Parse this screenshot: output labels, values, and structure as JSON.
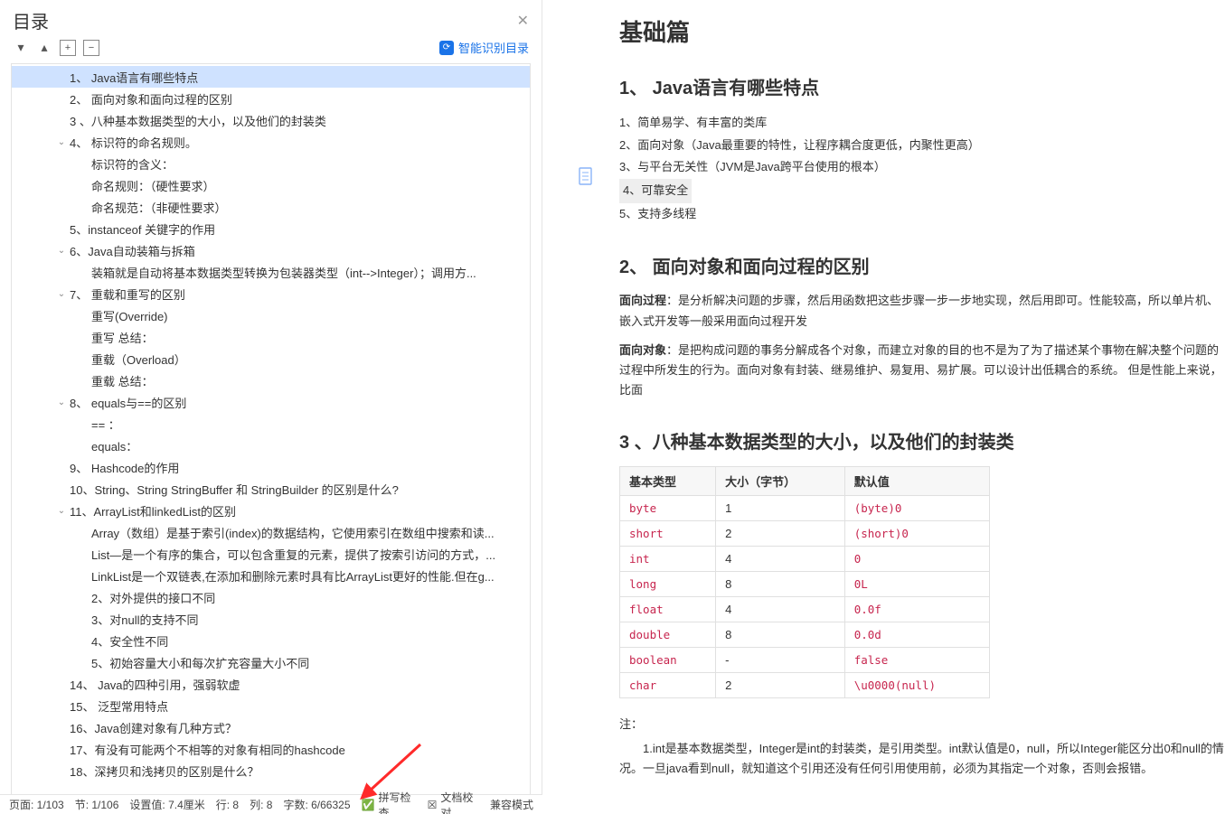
{
  "outline_panel": {
    "title": "目录",
    "smart_label": "智能识别目录",
    "buttons": {
      "collapse_all": "▾",
      "up": "▴",
      "add": "+",
      "remove": "−"
    }
  },
  "outline_items": [
    {
      "level": 0,
      "caret": "",
      "label": "1、 Java语言有哪些特点",
      "selected": true
    },
    {
      "level": 0,
      "caret": "",
      "label": "2、 面向对象和面向过程的区别"
    },
    {
      "level": 0,
      "caret": "",
      "label": "3 、八种基本数据类型的大小，以及他们的封装类"
    },
    {
      "level": 0,
      "caret": "open",
      "label": "4、 标识符的命名规则。"
    },
    {
      "level": 1,
      "caret": "",
      "label": "标识符的含义："
    },
    {
      "level": 1,
      "caret": "",
      "label": "命名规则：（硬性要求）"
    },
    {
      "level": 1,
      "caret": "",
      "label": "命名规范：（非硬性要求）"
    },
    {
      "level": 0,
      "caret": "",
      "label": "5、instanceof 关键字的作用"
    },
    {
      "level": 0,
      "caret": "open",
      "label": "6、Java自动装箱与拆箱"
    },
    {
      "level": 1,
      "caret": "",
      "label": "装箱就是自动将基本数据类型转换为包装器类型（int-->Integer）；调用方..."
    },
    {
      "level": 0,
      "caret": "open",
      "label": "7、 重载和重写的区别"
    },
    {
      "level": 1,
      "caret": "",
      "label": "重写(Override)"
    },
    {
      "level": 1,
      "caret": "",
      "label": "重写 总结："
    },
    {
      "level": 1,
      "caret": "",
      "label": "重载（Overload）"
    },
    {
      "level": 1,
      "caret": "",
      "label": "重载 总结："
    },
    {
      "level": 0,
      "caret": "open",
      "label": "8、 equals与==的区别"
    },
    {
      "level": 1,
      "caret": "",
      "label": "==  ："
    },
    {
      "level": 1,
      "caret": "",
      "label": "equals："
    },
    {
      "level": 0,
      "caret": "",
      "label": "9、 Hashcode的作用"
    },
    {
      "level": 0,
      "caret": "",
      "label": "10、String、String StringBuffer 和 StringBuilder 的区别是什么?"
    },
    {
      "level": 0,
      "caret": "open",
      "label": "11、ArrayList和linkedList的区别"
    },
    {
      "level": 1,
      "caret": "",
      "label": "Array（数组）是基于索引(index)的数据结构，它使用索引在数组中搜索和读..."
    },
    {
      "level": 1,
      "caret": "",
      "label": "List—是一个有序的集合，可以包含重复的元素，提供了按索引访问的方式，..."
    },
    {
      "level": 1,
      "caret": "",
      "label": "LinkList是一个双链表,在添加和删除元素时具有比ArrayList更好的性能.但在g..."
    },
    {
      "level": 1,
      "caret": "",
      "label": "2、对外提供的接口不同"
    },
    {
      "level": 1,
      "caret": "",
      "label": "3、对null的支持不同"
    },
    {
      "level": 1,
      "caret": "",
      "label": "4、安全性不同"
    },
    {
      "level": 1,
      "caret": "",
      "label": "5、初始容量大小和每次扩充容量大小不同"
    },
    {
      "level": 0,
      "caret": "",
      "label": "14、 Java的四种引用，强弱软虚"
    },
    {
      "level": 0,
      "caret": "",
      "label": "15、 泛型常用特点"
    },
    {
      "level": 0,
      "caret": "",
      "label": "16、Java创建对象有几种方式？"
    },
    {
      "level": 0,
      "caret": "",
      "label": "17、有没有可能两个不相等的对象有相同的hashcode"
    },
    {
      "level": 0,
      "caret": "",
      "label": "18、深拷贝和浅拷贝的区别是什么？"
    }
  ],
  "doc": {
    "h_basic": "基础篇",
    "h1": "1、 Java语言有哪些特点",
    "p1_1": "1、简单易学、有丰富的类库",
    "p1_2": "2、面向对象（Java最重要的特性，让程序耦合度更低，内聚性更高）",
    "p1_3": "3、与平台无关性（JVM是Java跨平台使用的根本）",
    "p1_4": "4、可靠安全",
    "p1_5": "5、支持多线程",
    "h2": "2、 面向对象和面向过程的区别",
    "s2a_label": "面向过程",
    "s2a_body": "：是分析解决问题的步骤，然后用函数把这些步骤一步一步地实现，然后用即可。性能较高，所以单片机、嵌入式开发等一般采用面向过程开发",
    "s2b_label": "面向对象",
    "s2b_body": "：是把构成问题的事务分解成各个对象，而建立对象的目的也不是为了为了描述某个事物在解决整个问题的过程中所发生的行为。面向对象有封装、继易维护、易复用、易扩展。可以设计出低耦合的系统。 但是性能上来说，比面",
    "h3": "3 、八种基本数据类型的大小，以及他们的封装类",
    "table_head": [
      "基本类型",
      "大小（字节）",
      "默认值"
    ],
    "table_rows": [
      [
        "byte",
        "1",
        "(byte)0"
      ],
      [
        "short",
        "2",
        "(short)0"
      ],
      [
        "int",
        "4",
        "0"
      ],
      [
        "long",
        "8",
        "0L"
      ],
      [
        "float",
        "4",
        "0.0f"
      ],
      [
        "double",
        "8",
        "0.0d"
      ],
      [
        "boolean",
        "-",
        "false"
      ],
      [
        "char",
        "2",
        "\\u0000(null)"
      ]
    ],
    "note_label": "注：",
    "note_body": "1.int是基本数据类型，Integer是int的封装类，是引用类型。int默认值是0，null，所以Integer能区分出0和null的情况。一旦java看到null，就知道这个引用还没有任何引用使用前，必须为其指定一个对象，否则会报错。"
  },
  "statusbar": {
    "page": "页面: 1/103",
    "section": "节: 1/106",
    "setvalue": "设置值: 7.4厘米",
    "row": "行: 8",
    "col": "列: 8",
    "chars": "字数: 6/66325",
    "spell": "拼写检查",
    "proof": "文档校对",
    "compat": "兼容模式"
  }
}
